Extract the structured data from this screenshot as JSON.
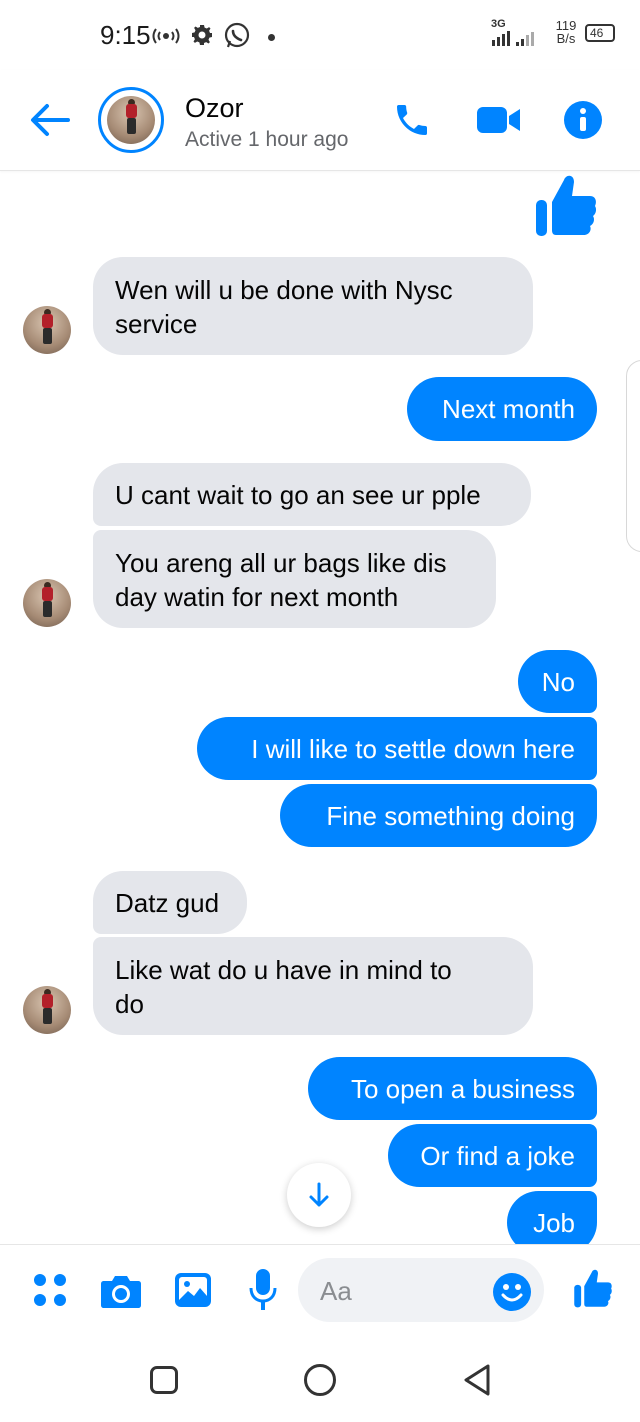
{
  "status_bar": {
    "time": "9:15",
    "network_type": "3G",
    "speed_value": "119",
    "speed_unit": "B/s",
    "battery": "46"
  },
  "header": {
    "contact_name": "Ozor",
    "presence": "Active 1 hour ago"
  },
  "messages": [
    {
      "id": "m1",
      "direction": "incoming",
      "text_lines": [
        "Wen will u be done with Nysc",
        "service"
      ]
    },
    {
      "id": "m2",
      "direction": "outgoing",
      "text_lines": [
        "Next month"
      ]
    },
    {
      "id": "m3",
      "direction": "incoming",
      "text_lines": [
        "U cant wait to go an see ur pple"
      ]
    },
    {
      "id": "m4",
      "direction": "incoming",
      "text_lines": [
        "You areng all ur bags like dis",
        "day watin for next month"
      ]
    },
    {
      "id": "m5",
      "direction": "outgoing",
      "text_lines": [
        "No"
      ]
    },
    {
      "id": "m6",
      "direction": "outgoing",
      "text_lines": [
        "I will like to settle down here"
      ]
    },
    {
      "id": "m7",
      "direction": "outgoing",
      "text_lines": [
        "Fine something doing"
      ]
    },
    {
      "id": "m8",
      "direction": "incoming",
      "text_lines": [
        "Datz gud"
      ]
    },
    {
      "id": "m9",
      "direction": "incoming",
      "text_lines": [
        "Like wat do u have in mind to",
        "do"
      ]
    },
    {
      "id": "m10",
      "direction": "outgoing",
      "text_lines": [
        "To open a business"
      ]
    },
    {
      "id": "m11",
      "direction": "outgoing",
      "text_lines": [
        "Or find a joke"
      ]
    },
    {
      "id": "m12",
      "direction": "outgoing",
      "text_lines": [
        "Job"
      ]
    }
  ],
  "composer": {
    "placeholder": "Aa"
  },
  "icons": {
    "back": "back-arrow-icon",
    "call": "phone-icon",
    "video": "video-camera-icon",
    "info": "info-icon",
    "like": "thumbs-up-icon",
    "apps": "apps-grid-icon",
    "camera": "camera-icon",
    "gallery": "image-icon",
    "mic": "microphone-icon",
    "emoji": "emoji-icon",
    "scroll_down": "arrow-down-icon"
  },
  "colors": {
    "accent": "#0084ff",
    "incoming_bubble": "#e4e6eb",
    "secondary_text": "#65676b"
  }
}
